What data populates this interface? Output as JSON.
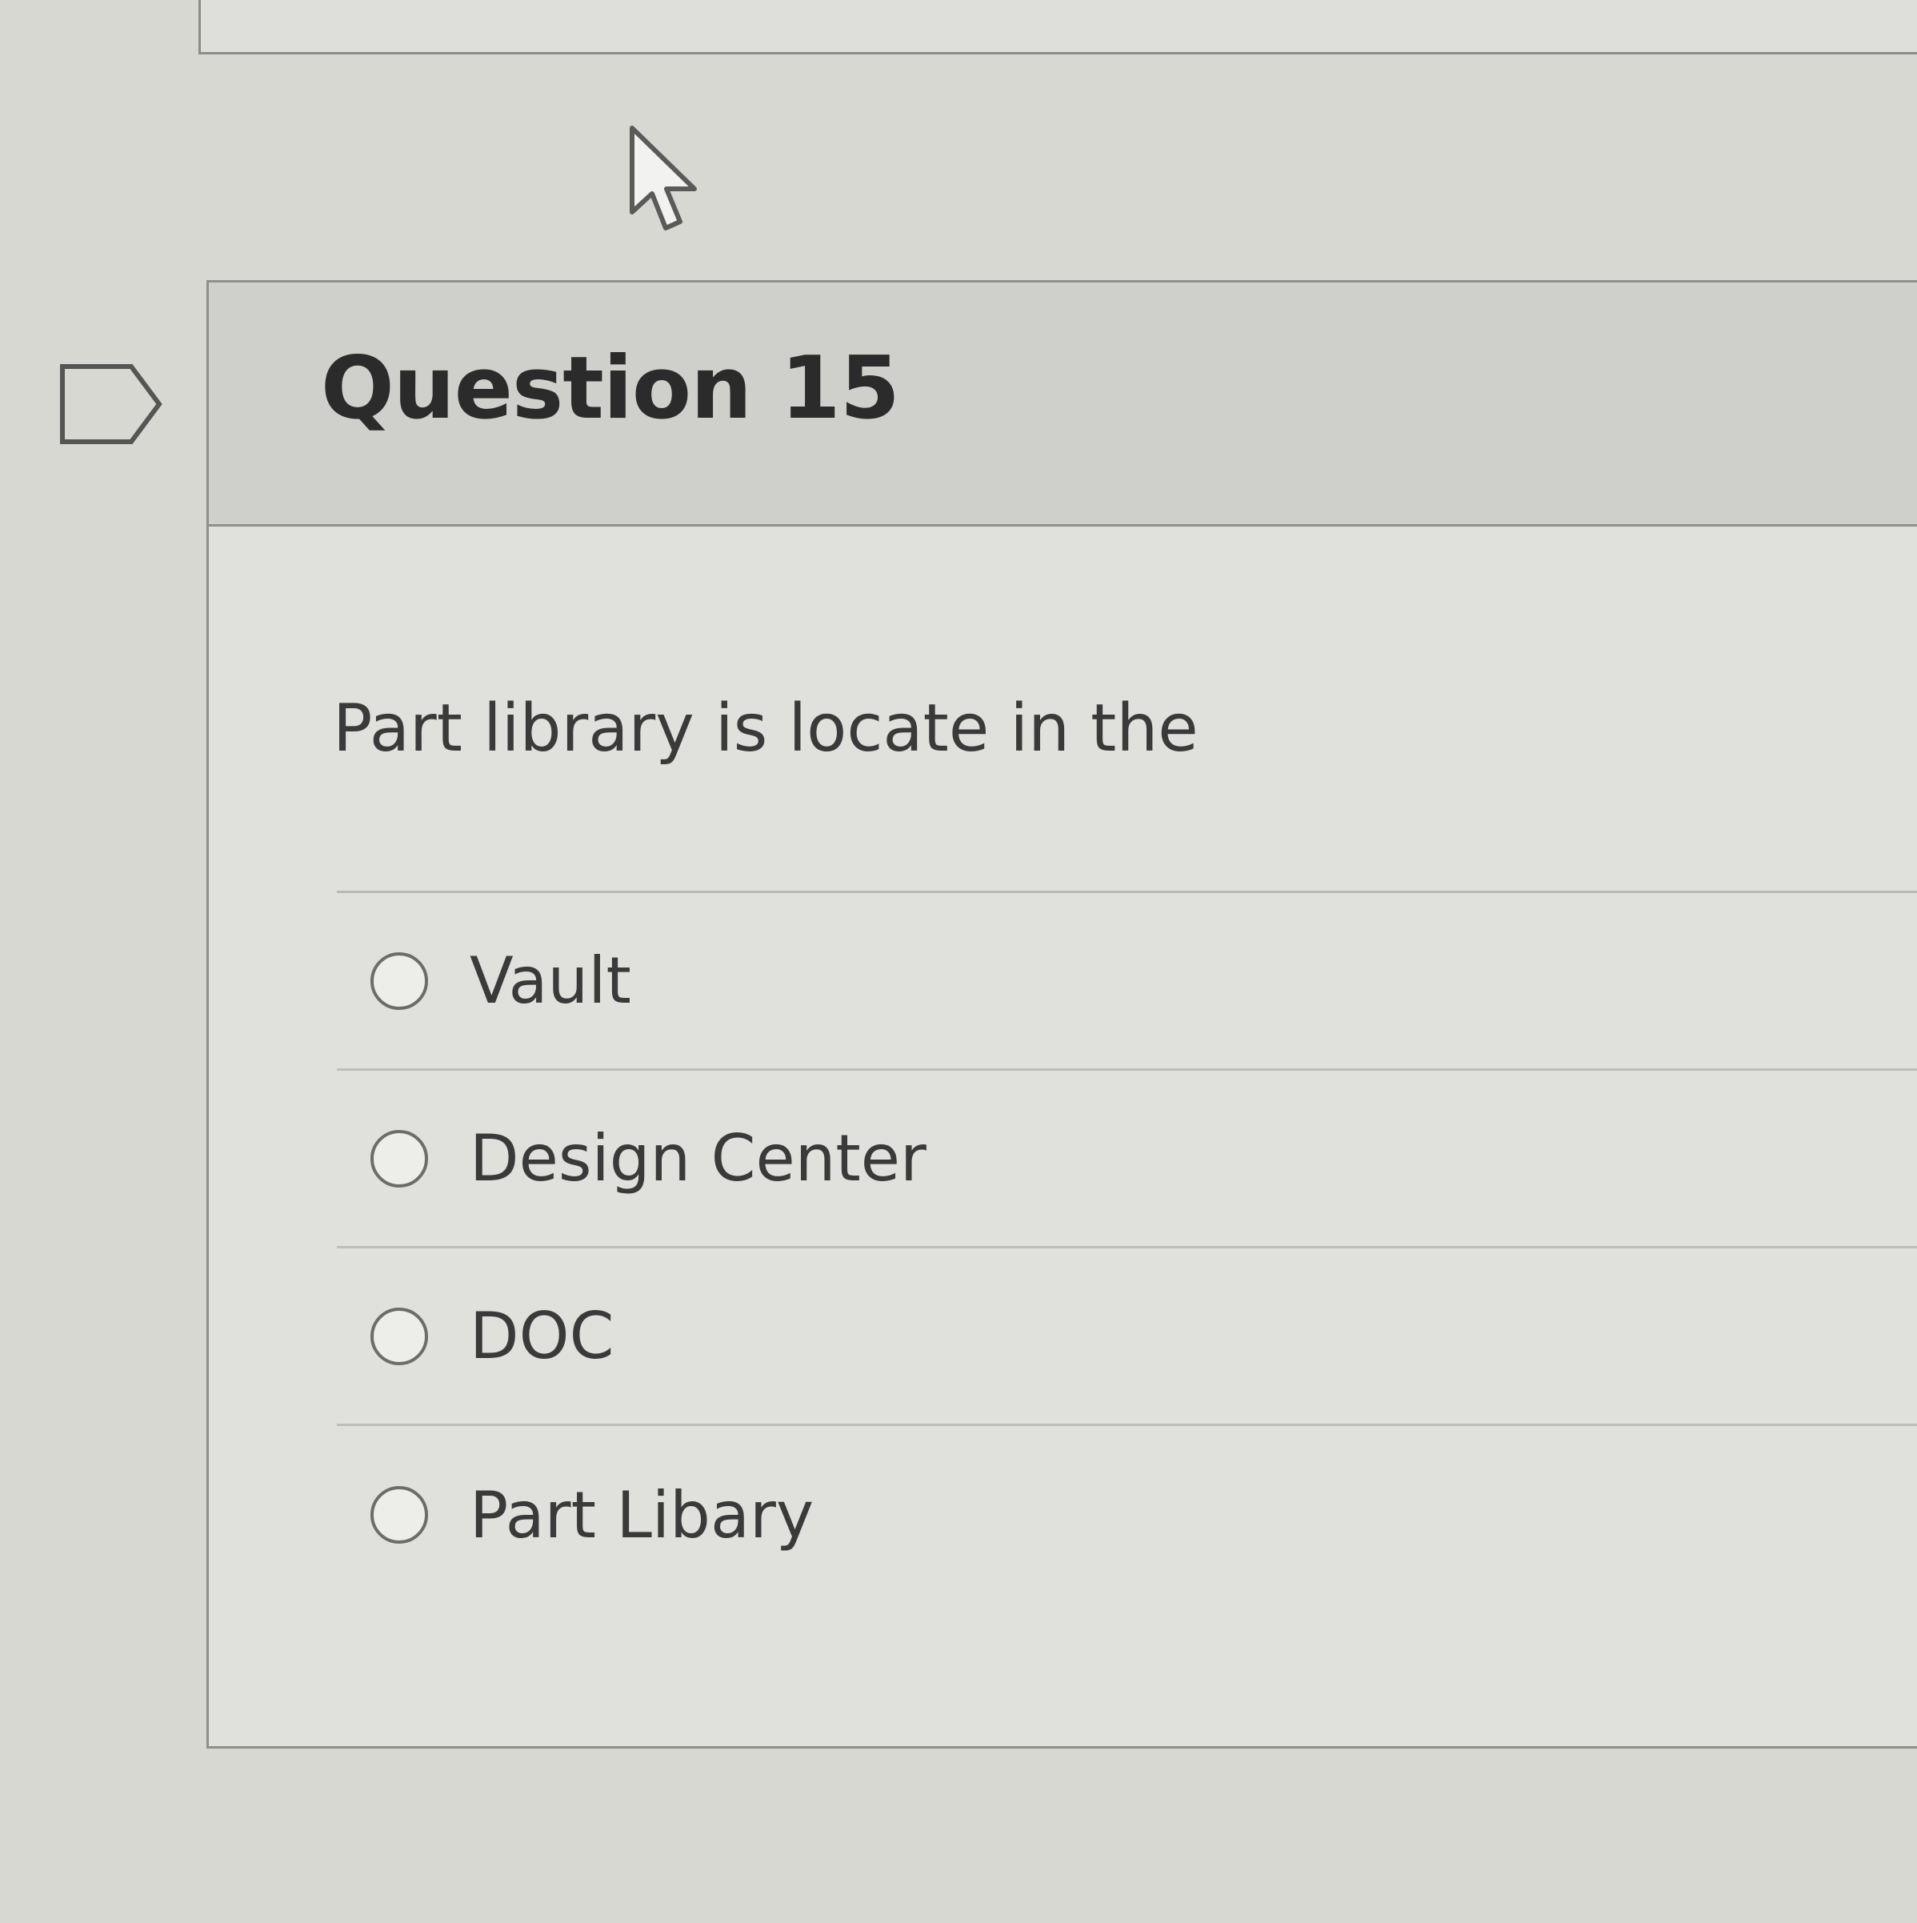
{
  "question": {
    "title": "Question 15",
    "text": "Part library is locate in the",
    "options": [
      {
        "label": "Vault"
      },
      {
        "label": "Design Center"
      },
      {
        "label": "DOC"
      },
      {
        "label": "Part Libary"
      }
    ]
  },
  "icons": {
    "cursor": "mouse-pointer-icon",
    "flag": "flag-question-icon",
    "radio": "radio-unchecked-icon"
  },
  "colors": {
    "background": "#d8d8d3",
    "header_background": "#cfcfcb",
    "border": "#8f8f8b",
    "text": "#333333"
  }
}
